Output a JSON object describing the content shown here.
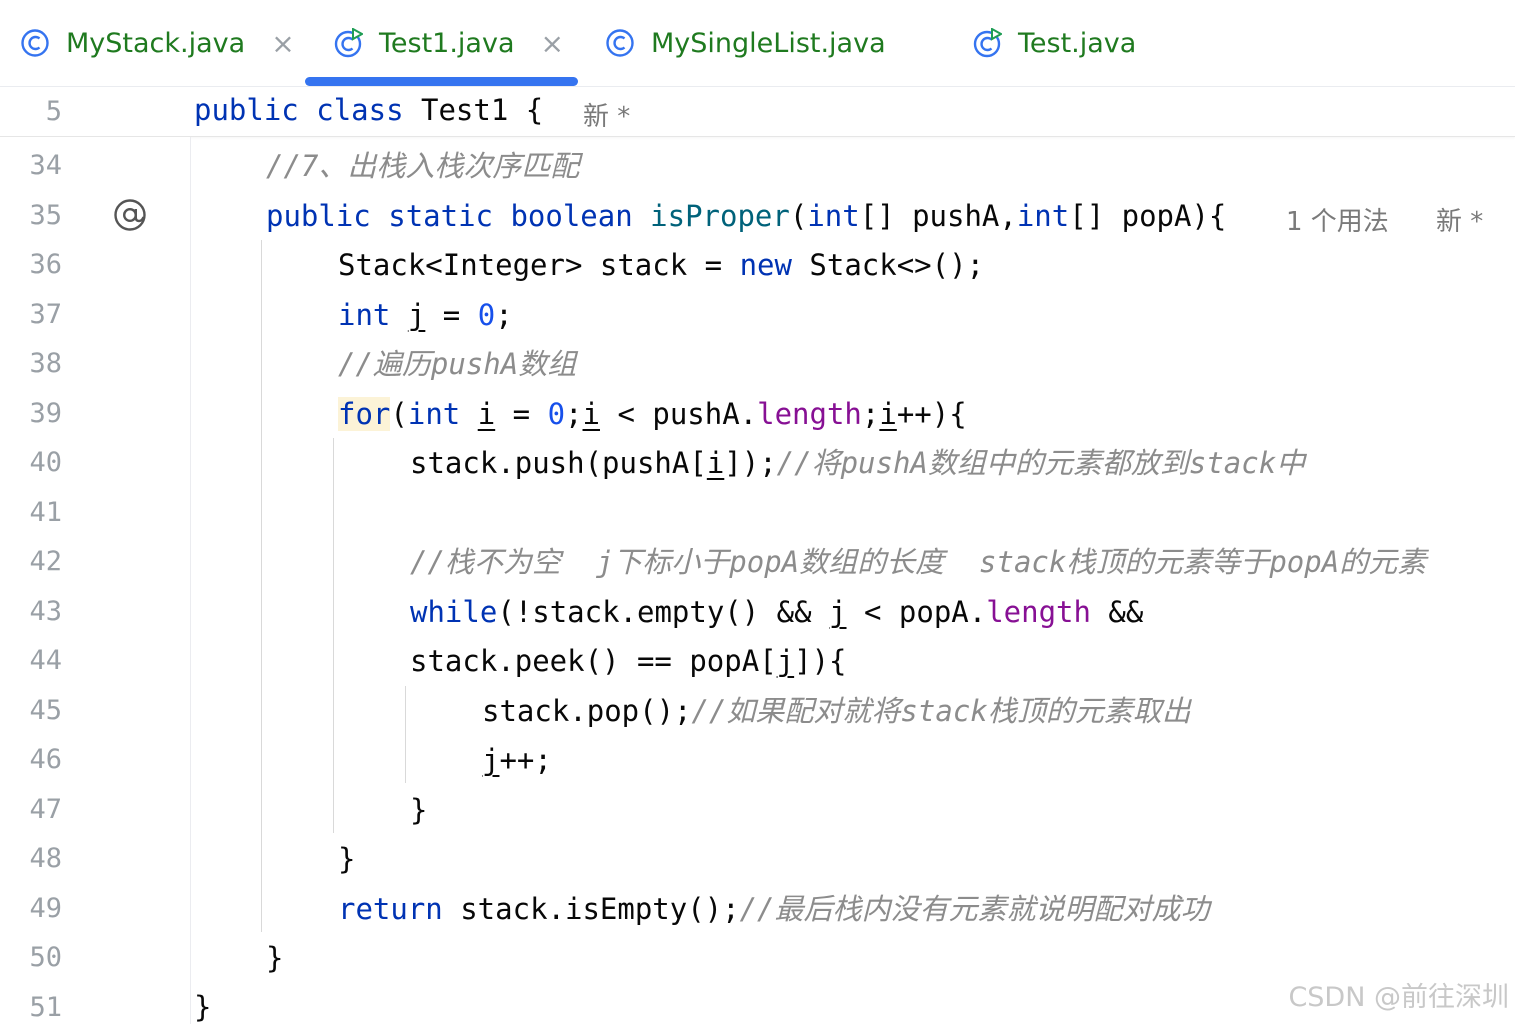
{
  "tabs": [
    {
      "label": "MyStack.java",
      "close": "×",
      "icon": "class-icon"
    },
    {
      "label": "Test1.java",
      "close": "×",
      "icon": "runnable-class-icon",
      "active": true
    },
    {
      "label": "MySingleList.java",
      "icon": "class-icon"
    },
    {
      "label": "Test.java",
      "icon": "runnable-class-icon"
    }
  ],
  "colors": {
    "accent": "#3574f0",
    "tab_text": "#1f7a1f",
    "keyword": "#0033b3",
    "comment": "#8c8c8c",
    "field": "#871094",
    "number": "#1750eb"
  },
  "sticky": {
    "line": "5",
    "t_public": "public",
    "t_class": "class",
    "t_name": " Test1 {",
    "hint": "新 *"
  },
  "lines": {
    "l34": {
      "num": "34",
      "comment": "//7、出栈入栈次序匹配"
    },
    "l35": {
      "num": "35",
      "t_public": "public",
      "t_static": "static",
      "t_boolean": "boolean",
      "t_method": "isProper",
      "t_open": "(",
      "t_int1": "int",
      "t_p1": "[] pushA,",
      "t_int2": "int",
      "t_p2": "[] popA){",
      "hint_usage": "1 个用法",
      "hint_new": "新 *"
    },
    "l36": {
      "num": "36",
      "t_a": "Stack<Integer> stack = ",
      "t_new": "new",
      "t_b": " Stack<>();"
    },
    "l37": {
      "num": "37",
      "t_int": "int",
      "t_j": "j",
      "t_eq": " = ",
      "t_zero": "0",
      "t_semi": ";"
    },
    "l38": {
      "num": "38",
      "comment": "//遍历pushA数组"
    },
    "l39": {
      "num": "39",
      "t_for": "for",
      "t_open": "(",
      "t_int": "int",
      "t_i1": "i",
      "t_eq": " = ",
      "t_zero": "0",
      "t_semi1": ";",
      "t_i2": "i",
      "t_lt": " < pushA.",
      "t_length": "length",
      "t_semi2": ";",
      "t_i3": "i",
      "t_end": "++){"
    },
    "l40": {
      "num": "40",
      "t_a": "stack.push(pushA[",
      "t_i": "i",
      "t_b": "]);",
      "comment": "//将pushA数组中的元素都放到stack中"
    },
    "l41": {
      "num": "41"
    },
    "l42": {
      "num": "42",
      "comment": "//栈不为空  j下标小于popA数组的长度  stack栈顶的元素等于popA的元素"
    },
    "l43": {
      "num": "43",
      "t_while": "while",
      "t_a": "(!stack.empty() && ",
      "t_j": "j",
      "t_b": " < popA.",
      "t_length": "length",
      "t_c": " &&"
    },
    "l44": {
      "num": "44",
      "t_a": "stack.peek() == popA[",
      "t_j": "j",
      "t_b": "]){"
    },
    "l45": {
      "num": "45",
      "t_a": "stack.pop();",
      "comment": "//如果配对就将stack栈顶的元素取出"
    },
    "l46": {
      "num": "46",
      "t_j": "j",
      "t_b": "++;"
    },
    "l47": {
      "num": "47",
      "t_a": "}"
    },
    "l48": {
      "num": "48",
      "t_a": "}"
    },
    "l49": {
      "num": "49",
      "t_return": "return",
      "t_a": " stack.isEmpty();",
      "comment": "//最后栈内没有元素就说明配对成功"
    },
    "l50": {
      "num": "50",
      "t_a": "}"
    },
    "l51": {
      "num": "51",
      "t_a": "}"
    }
  },
  "watermark": "CSDN @前往深圳"
}
